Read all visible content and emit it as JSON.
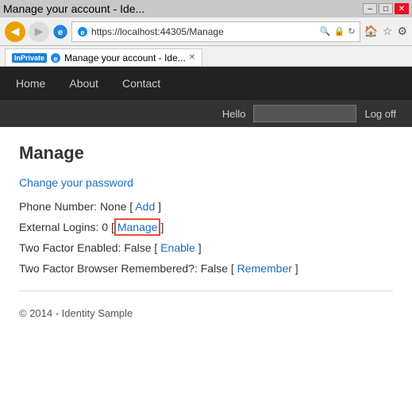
{
  "browser": {
    "title": "Manage your account - Ide...",
    "url": "https://localhost:44305/Manage",
    "back_label": "◀",
    "forward_label": "▶",
    "inprivate_label": "InPrivate",
    "tab_close": "✕",
    "min_label": "–",
    "max_label": "□",
    "close_label": "✕"
  },
  "nav": {
    "home_label": "Home",
    "about_label": "About",
    "contact_label": "Contact",
    "hello_label": "Hello",
    "logoff_label": "Log off"
  },
  "page": {
    "title": "Manage",
    "change_password_label": "Change your password",
    "phone_row": "Phone Number: None [",
    "phone_add": "Add",
    "phone_end": "]",
    "external_row": "External Logins: 0 [",
    "external_manage": "Manage",
    "external_end": "]",
    "twofactor_row": "Two Factor Enabled: False [",
    "twofactor_enable": "Enable",
    "twofactor_end": "]",
    "browser_row": "Two Factor Browser Remembered?: False [",
    "browser_remember": "Remember",
    "browser_end": "]",
    "footer": "© 2014 - Identity Sample"
  }
}
